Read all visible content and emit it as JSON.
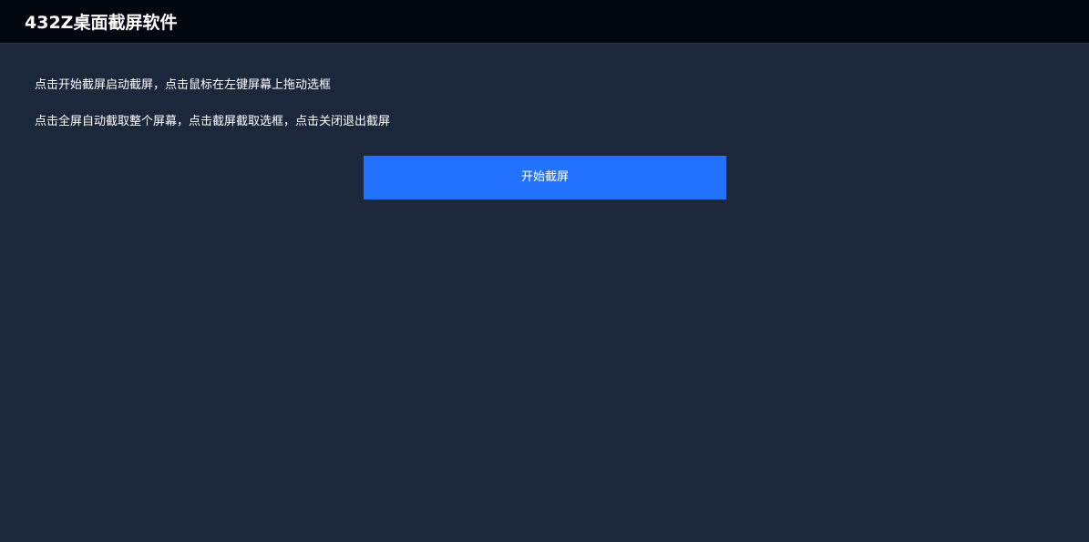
{
  "app": {
    "title": "432Z桌面截屏软件"
  },
  "instructions": [
    "点击开始截屏启动截屏，点击鼠标在左键屏幕上拖动选框",
    "点击全屏自动截取整个屏幕，点击截屏截取选框，点击关闭退出截屏"
  ],
  "actions": {
    "start_label": "开始截屏"
  },
  "colors": {
    "header_background": "#020710",
    "page_background": "#1b273b",
    "button_background": "#2272ff",
    "text": "#ffffff"
  }
}
